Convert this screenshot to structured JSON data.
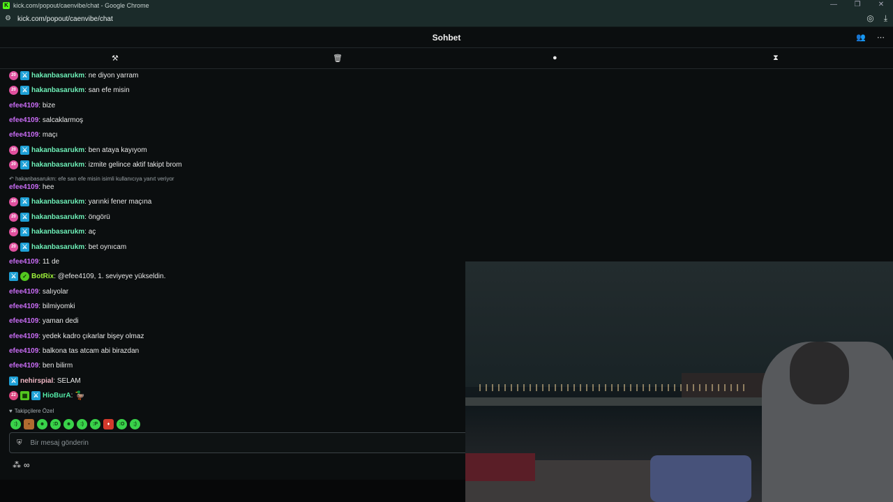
{
  "browser": {
    "window_title": "kick.com/popout/caenvibe/chat - Google Chrome",
    "url": "kick.com/popout/caenvibe/chat"
  },
  "chat": {
    "title": "Sohbet",
    "reply_notice": "hakanbasarukm: efe san efe misin isimli kullanıcıya yanıt veriyor",
    "followers_label": "Takipçilere Özel",
    "input_placeholder": "Bir mesaj gönderin",
    "messages": [
      {
        "user": "hakanbasarukm",
        "text": "ne diyon yarram",
        "sub": "20"
      },
      {
        "user": "hakanbasarukm",
        "text": "san efe misin",
        "sub": "20"
      },
      {
        "user": "efee4109",
        "text": "bize"
      },
      {
        "user": "efee4109",
        "text": "salcaklarmoş"
      },
      {
        "user": "efee4109",
        "text": "maçı"
      },
      {
        "user": "hakanbasarukm",
        "text": "ben ataya kayıyom",
        "sub": "20"
      },
      {
        "user": "hakanbasarukm",
        "text": "izmite gelince aktif takipt brom",
        "sub": "20"
      },
      {
        "user": "efee4109",
        "text": "hee"
      },
      {
        "user": "hakanbasarukm",
        "text": "yarınki fener maçına",
        "sub": "20"
      },
      {
        "user": "hakanbasarukm",
        "text": "öngörü",
        "sub": "20"
      },
      {
        "user": "hakanbasarukm",
        "text": "aç",
        "sub": "20"
      },
      {
        "user": "hakanbasarukm",
        "text": "bet oynıcam",
        "sub": "20"
      },
      {
        "user": "efee4109",
        "text": "11 de"
      },
      {
        "user": "BotRix",
        "text": "@efee4109, 1. seviyeye yükseldin."
      },
      {
        "user": "efee4109",
        "text": "salıyolar"
      },
      {
        "user": "efee4109",
        "text": "bilmiyomki"
      },
      {
        "user": "efee4109",
        "text": "yaman dedi"
      },
      {
        "user": "efee4109",
        "text": "yedek kadro çıkarlar bişey olmaz"
      },
      {
        "user": "efee4109",
        "text": "balkona tas atcam abi birazdan"
      },
      {
        "user": "efee4109",
        "text": "ben bilirm"
      },
      {
        "user": "nehirspial",
        "text": "SELAM"
      },
      {
        "user": "HioBurA",
        "text": "",
        "sub": "22"
      }
    ]
  },
  "colors": {
    "accent": "#53fc18",
    "user_green": "#6ef0b8",
    "user_purple": "#c96cf5"
  }
}
